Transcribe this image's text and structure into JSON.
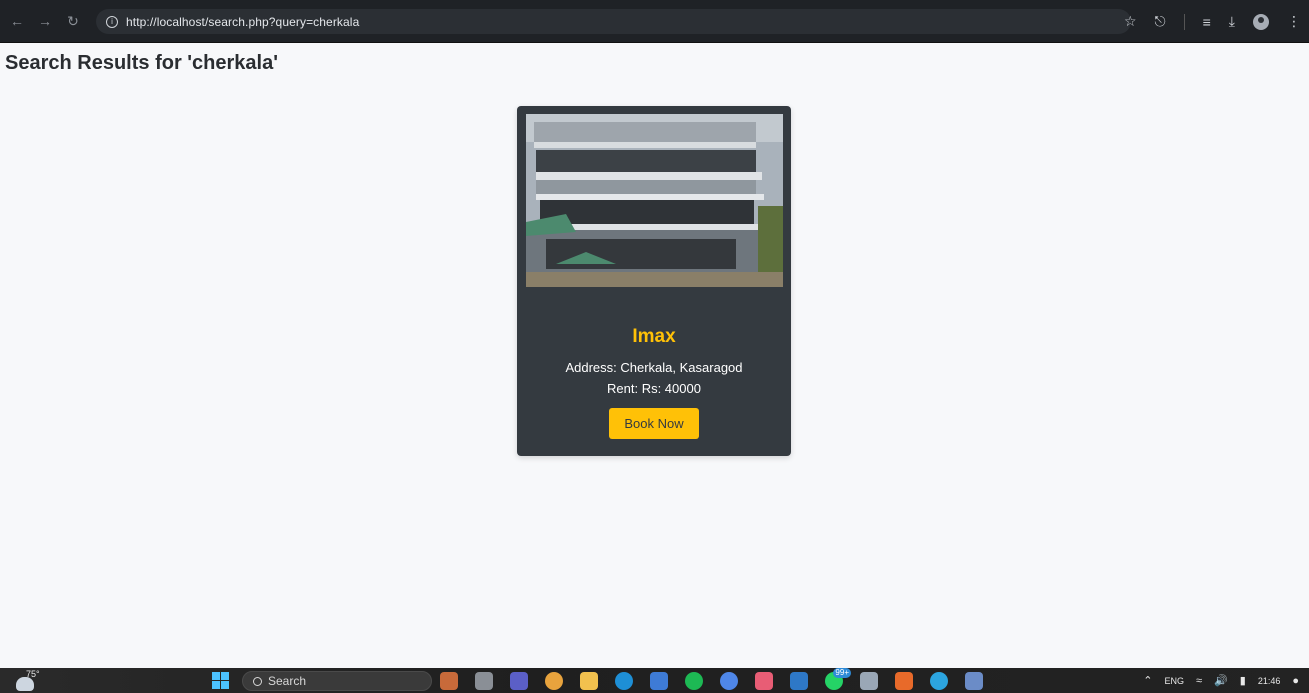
{
  "browser": {
    "url": "http://localhost/search.php?query=cherkala",
    "icons": [
      "back-arrow-icon",
      "forward-arrow-icon",
      "reload-icon",
      "info-icon",
      "star-icon",
      "extensions-icon",
      "reading-list-icon",
      "download-icon",
      "profile-icon",
      "menu-icon"
    ]
  },
  "page": {
    "title": "Search Results for 'cherkala'"
  },
  "results": [
    {
      "name": "Imax",
      "address": "Address: Cherkala, Kasaragod",
      "rent": "Rent: Rs: 40000",
      "button": "Book Now"
    }
  ],
  "colors": {
    "card_bg": "#343a40",
    "accent": "#ffc107",
    "page_bg": "#f7f8fa",
    "browser_bar": "#1f2226"
  },
  "taskbar": {
    "weather_temp": "75°",
    "search_label": "Search",
    "badges": {
      "whatsapp": "99+"
    },
    "lang": "ENG",
    "time": "21:46"
  }
}
